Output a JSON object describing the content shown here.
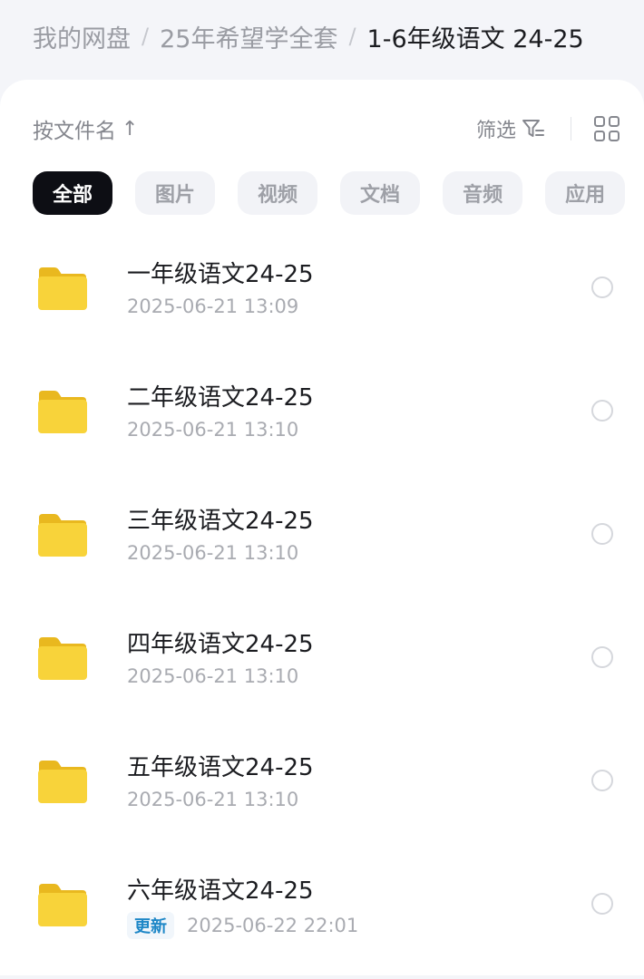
{
  "breadcrumb": {
    "items": [
      "我的网盘",
      "25年希望学全套",
      "1-6年级语文 24-25"
    ],
    "separator": "/"
  },
  "toolbar": {
    "sort_label": "按文件名",
    "sort_arrow": "↑",
    "filter_label": "筛选"
  },
  "chips": [
    "全部",
    "图片",
    "视频",
    "文档",
    "音频",
    "应用"
  ],
  "files": [
    {
      "name": "一年级语文24-25",
      "date": "2025-06-21  13:09",
      "badge": ""
    },
    {
      "name": "二年级语文24-25",
      "date": "2025-06-21  13:10",
      "badge": ""
    },
    {
      "name": "三年级语文24-25",
      "date": "2025-06-21  13:10",
      "badge": ""
    },
    {
      "name": "四年级语文24-25",
      "date": "2025-06-21  13:10",
      "badge": ""
    },
    {
      "name": "五年级语文24-25",
      "date": "2025-06-21  13:10",
      "badge": ""
    },
    {
      "name": "六年级语文24-25",
      "date": "2025-06-22  22:01",
      "badge": "更新"
    }
  ],
  "icons": {
    "file": "folder-icon",
    "filter": "filter-icon",
    "view": "grid-view-icon",
    "select": "radio-circle-icon"
  },
  "colors": {
    "folder": "#F8D33A",
    "active_chip": "#0D0E14",
    "badge_text": "#1E87C7"
  }
}
